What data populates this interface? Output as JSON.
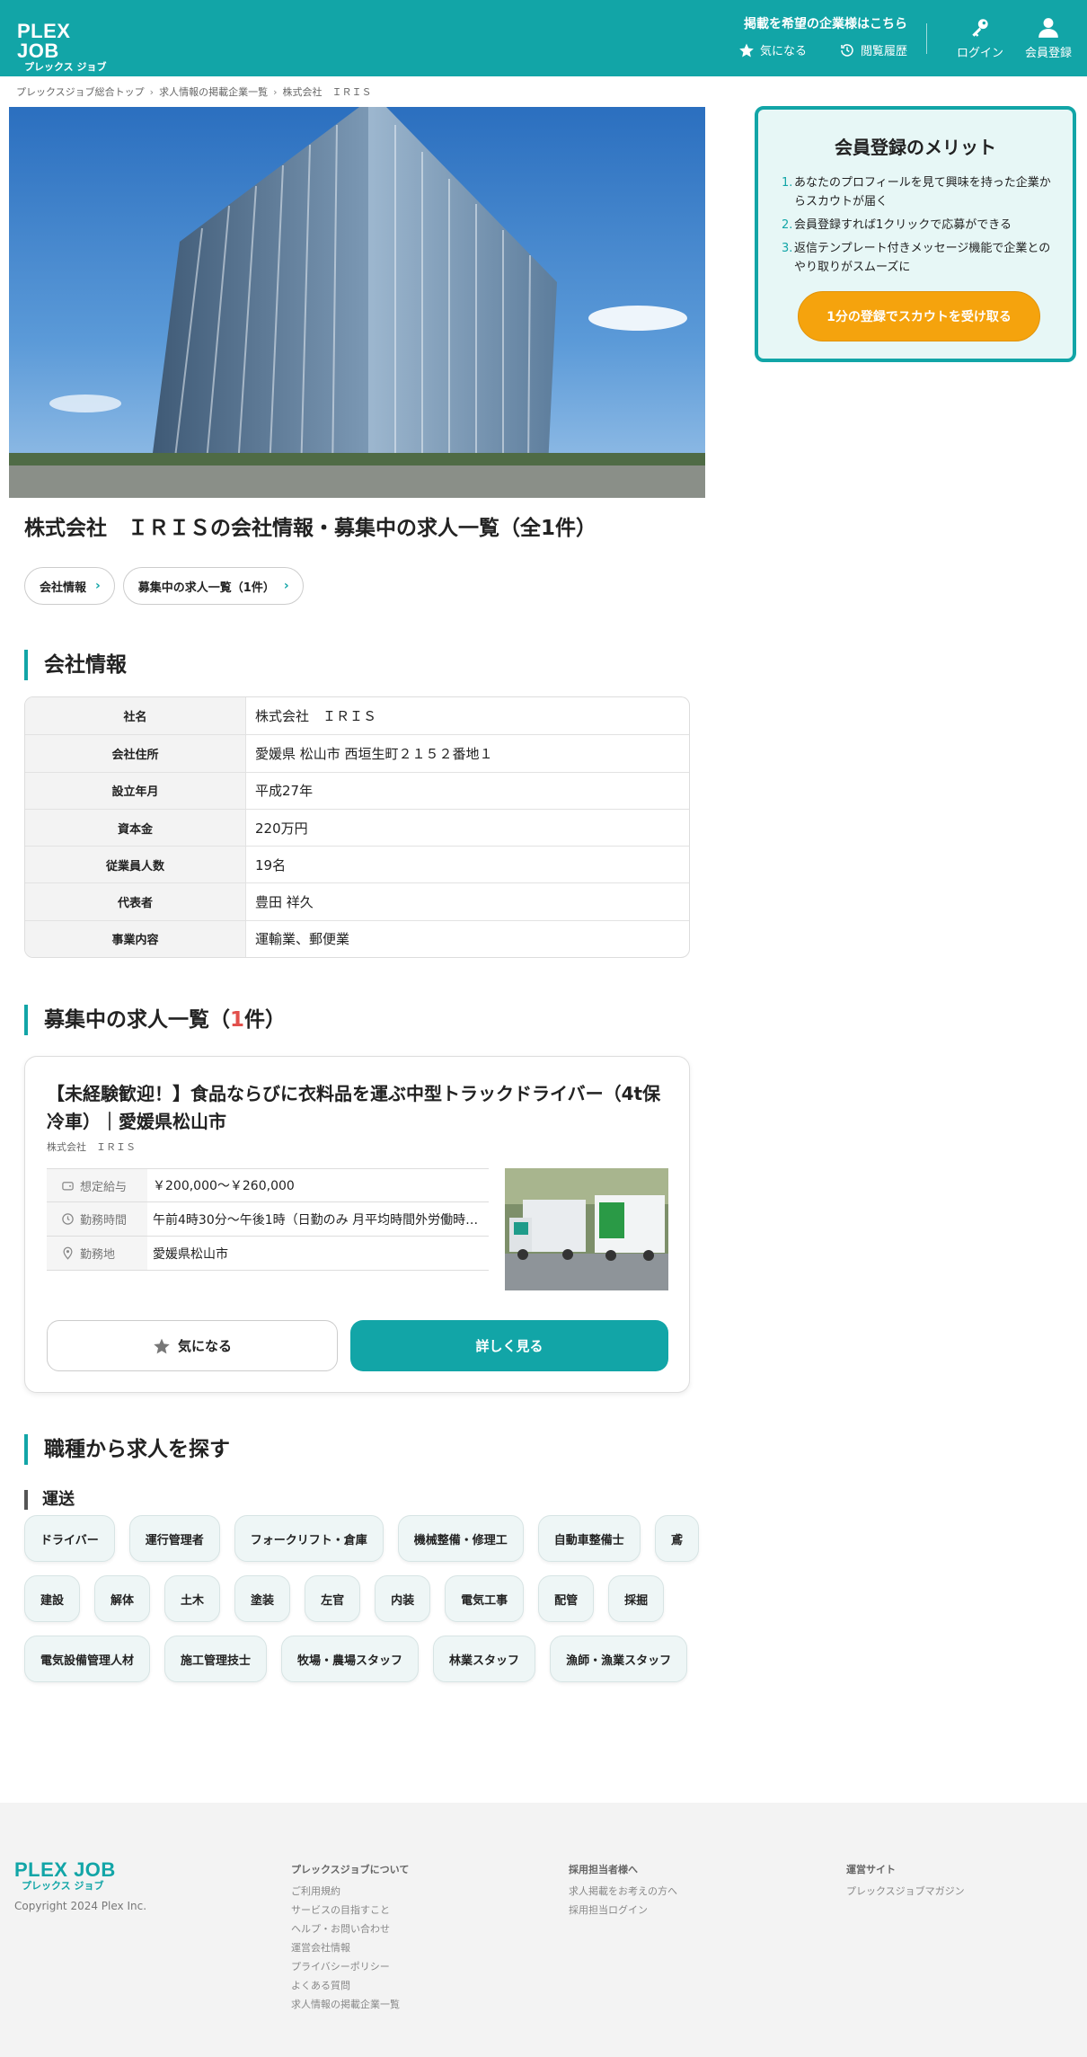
{
  "header": {
    "logo_main": "PLEX JOB",
    "logo_sub": "プレックス ジョブ",
    "notice": "掲載を希望の企業様はこちら",
    "fav_label": "気になる",
    "history_label": "閲覧履歴",
    "login_label": "ログイン",
    "register_label": "会員登録"
  },
  "breadcrumb": [
    "プレックスジョブ総合トップ",
    "求人情報の掲載企業一覧",
    "株式会社　ＩＲＩＳ"
  ],
  "page_title": "株式会社　ＩＲＩＳの会社情報・募集中の求人一覧（全1件）",
  "pills": [
    "会社情報",
    "募集中の求人一覧（1件）"
  ],
  "company_section": {
    "heading": "会社情報",
    "rows": [
      {
        "key": "社名",
        "value": "株式会社　ＩＲＩＳ"
      },
      {
        "key": "会社住所",
        "value": "愛媛県 松山市 西垣生町２１５２番地１"
      },
      {
        "key": "設立年月",
        "value": "平成27年"
      },
      {
        "key": "資本金",
        "value": "220万円"
      },
      {
        "key": "従業員人数",
        "value": "19名"
      },
      {
        "key": "代表者",
        "value": "豊田 祥久"
      },
      {
        "key": "事業内容",
        "value": "運輸業、郵便業"
      }
    ]
  },
  "jobs_section": {
    "heading_prefix": "募集中の求人一覧（",
    "heading_count": "1",
    "heading_suffix": "件）",
    "job": {
      "title": "【未経験歓迎！】食品ならびに衣料品を運ぶ中型トラックドライバー（4t保冷車）｜愛媛県松山市",
      "company": "株式会社　ＩＲＩＳ",
      "salary_label": "想定給与",
      "salary": "￥200,000〜￥260,000",
      "hours_label": "勤務時間",
      "hours": "午前4時30分〜午後1時（日勤のみ 月平均時間外労働時間...",
      "location_label": "勤務地",
      "location": "愛媛県松山市",
      "fav_button": "気になる",
      "detail_button": "詳しく見る"
    }
  },
  "category_section": {
    "heading": "職種から求人を探す",
    "subheading": "運送",
    "chips": [
      "ドライバー",
      "運行管理者",
      "フォークリフト・倉庫",
      "機械整備・修理工",
      "自動車整備士",
      "鳶",
      "建設",
      "解体",
      "土木",
      "塗装",
      "左官",
      "内装",
      "電気工事",
      "配管",
      "採掘",
      "電気設備管理人材",
      "施工管理技士",
      "牧場・農場スタッフ",
      "林業スタッフ",
      "漁師・漁業スタッフ"
    ]
  },
  "sidebar": {
    "title": "会員登録のメリット",
    "items": [
      {
        "num": "1.",
        "text": "あなたのプロフィールを見て興味を持った企業からスカウトが届く"
      },
      {
        "num": "2.",
        "text": "会員登録すれば1クリックで応募ができる"
      },
      {
        "num": "3.",
        "text": "返信テンプレート付きメッセージ機能で企業とのやり取りがスムーズに"
      }
    ],
    "button": "1分の登録でスカウトを受け取る"
  },
  "footer": {
    "logo_main": "PLEX JOB",
    "logo_sub": "プレックス ジョブ",
    "copyright": "Copyright 2024 Plex Inc.",
    "col1": {
      "heading": "プレックスジョブについて",
      "links": [
        "ご利用規約",
        "サービスの目指すこと",
        "ヘルプ・お問い合わせ",
        "運営会社情報",
        "プライバシーポリシー",
        "よくある質問",
        "求人情報の掲載企業一覧"
      ]
    },
    "col2": {
      "heading": "採用担当者様へ",
      "links": [
        "求人掲載をお考えの方へ",
        "採用担当ログイン"
      ]
    },
    "col3": {
      "heading": "運営サイト",
      "links": [
        "プレックスジョブマガジン"
      ]
    }
  },
  "colors": {
    "brand": "#12a5a7",
    "accent": "#f5a30d",
    "highlight": "#e2504c"
  }
}
